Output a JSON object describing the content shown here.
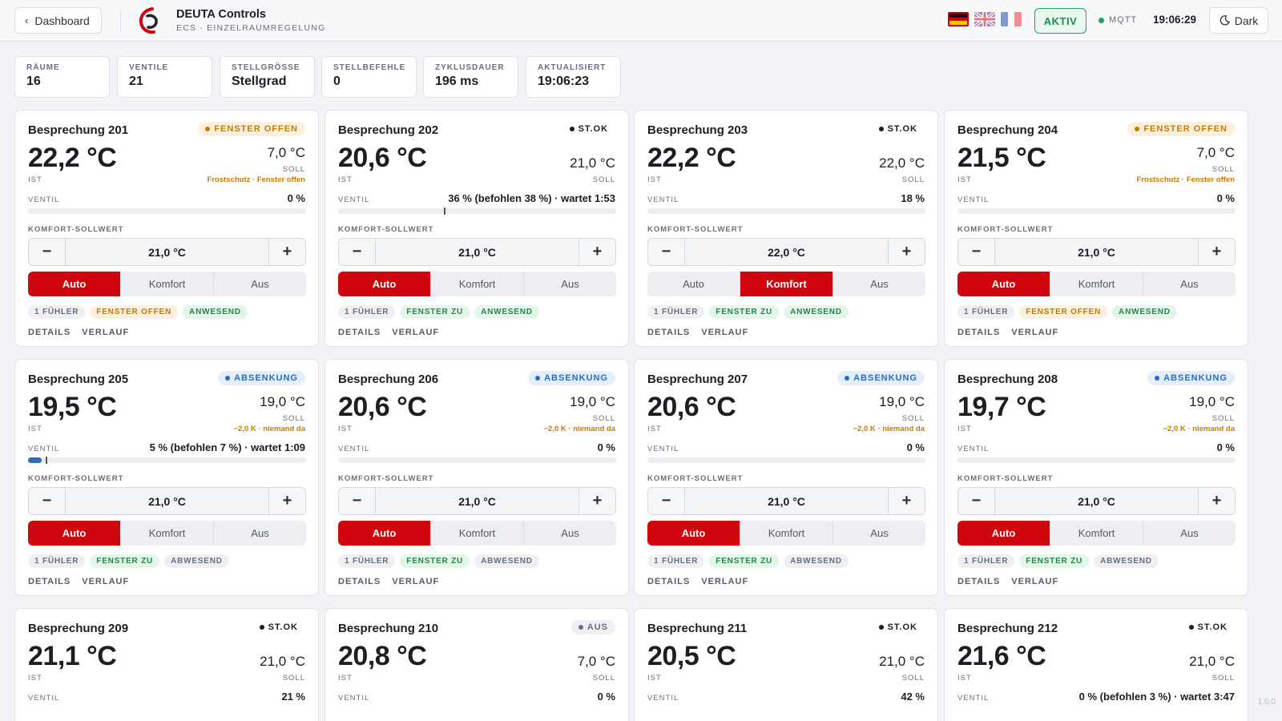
{
  "header": {
    "back_label": "Dashboard",
    "brand_title": "DEUTA Controls",
    "brand_subtitle": "ECS · EINZELRAUMREGELUNG",
    "status": "AKTIV",
    "mqtt": "MQTT",
    "clock": "19:06:29",
    "theme_label": "Dark",
    "flags": [
      "german-flag",
      "uk-flag",
      "french-flag"
    ]
  },
  "stats": [
    {
      "label": "RÄUME",
      "value": "16"
    },
    {
      "label": "VENTILE",
      "value": "21"
    },
    {
      "label": "STELLGRÖSSE",
      "value": "Stellgrad"
    },
    {
      "label": "STELLBEFEHLE",
      "value": "0"
    },
    {
      "label": "ZYKLUSDAUER",
      "value": "196 ms"
    },
    {
      "label": "AKTUALISIERT",
      "value": "19:06:23"
    }
  ],
  "labels": {
    "ist": "IST",
    "soll": "SOLL",
    "ventil": "VENTIL",
    "komfort": "KOMFORT-SOLLWERT",
    "minus": "−",
    "plus": "+",
    "mode_auto": "Auto",
    "mode_komfort": "Komfort",
    "mode_aus": "Aus",
    "details": "DETAILS",
    "verlauf": "VERLAUF"
  },
  "rooms": [
    {
      "name": "Besprechung 201",
      "badge": "FENSTER OFFEN",
      "badge_type": "open",
      "ist": "22,2 °C",
      "soll": "7,0 °C",
      "soll_note": "Frostschutz · Fenster offen",
      "ventil": "0 %",
      "ventil_level": 0,
      "marker_level": null,
      "komfort": "21,0 °C",
      "mode": "Auto",
      "tags": [
        {
          "t": "1 FÜHLER",
          "c": "gray"
        },
        {
          "t": "FENSTER OFFEN",
          "c": "orange"
        },
        {
          "t": "ANWESEND",
          "c": "green"
        }
      ]
    },
    {
      "name": "Besprechung 202",
      "badge": "ST.OK",
      "badge_type": "ok",
      "ist": "20,6 °C",
      "soll": "21,0 °C",
      "soll_note": "",
      "ventil": "36 % (befohlen 38 %) · wartet 1:53",
      "ventil_level": 0,
      "marker_level": 38,
      "komfort": "21,0 °C",
      "mode": "Auto",
      "tags": [
        {
          "t": "1 FÜHLER",
          "c": "gray"
        },
        {
          "t": "FENSTER ZU",
          "c": "green"
        },
        {
          "t": "ANWESEND",
          "c": "green"
        }
      ]
    },
    {
      "name": "Besprechung 203",
      "badge": "ST.OK",
      "badge_type": "ok",
      "ist": "22,2 °C",
      "soll": "22,0 °C",
      "soll_note": "",
      "ventil": "18 %",
      "ventil_level": 0,
      "marker_level": null,
      "komfort": "22,0 °C",
      "mode": "Komfort",
      "tags": [
        {
          "t": "1 FÜHLER",
          "c": "gray"
        },
        {
          "t": "FENSTER ZU",
          "c": "green"
        },
        {
          "t": "ANWESEND",
          "c": "green"
        }
      ]
    },
    {
      "name": "Besprechung 204",
      "badge": "FENSTER OFFEN",
      "badge_type": "open",
      "ist": "21,5 °C",
      "soll": "7,0 °C",
      "soll_note": "Frostschutz · Fenster offen",
      "ventil": "0 %",
      "ventil_level": 0,
      "marker_level": null,
      "komfort": "21,0 °C",
      "mode": "Auto",
      "tags": [
        {
          "t": "1 FÜHLER",
          "c": "gray"
        },
        {
          "t": "FENSTER OFFEN",
          "c": "orange"
        },
        {
          "t": "ANWESEND",
          "c": "green"
        }
      ]
    },
    {
      "name": "Besprechung 205",
      "badge": "ABSENKUNG",
      "badge_type": "ab",
      "ist": "19,5 °C",
      "soll": "19,0 °C",
      "soll_note": "−2,0 K · niemand da",
      "ventil": "5 % (befohlen 7 %) · wartet 1:09",
      "ventil_level": 5,
      "marker_level": 7,
      "komfort": "21,0 °C",
      "mode": "Auto",
      "tags": [
        {
          "t": "1 FÜHLER",
          "c": "gray"
        },
        {
          "t": "FENSTER ZU",
          "c": "green"
        },
        {
          "t": "ABWESEND",
          "c": "gray"
        }
      ]
    },
    {
      "name": "Besprechung 206",
      "badge": "ABSENKUNG",
      "badge_type": "ab",
      "ist": "20,6 °C",
      "soll": "19,0 °C",
      "soll_note": "−2,0 K · niemand da",
      "ventil": "0 %",
      "ventil_level": 0,
      "marker_level": null,
      "komfort": "21,0 °C",
      "mode": "Auto",
      "tags": [
        {
          "t": "1 FÜHLER",
          "c": "gray"
        },
        {
          "t": "FENSTER ZU",
          "c": "green"
        },
        {
          "t": "ABWESEND",
          "c": "gray"
        }
      ]
    },
    {
      "name": "Besprechung 207",
      "badge": "ABSENKUNG",
      "badge_type": "ab",
      "ist": "20,6 °C",
      "soll": "19,0 °C",
      "soll_note": "−2,0 K · niemand da",
      "ventil": "0 %",
      "ventil_level": 0,
      "marker_level": null,
      "komfort": "21,0 °C",
      "mode": "Auto",
      "tags": [
        {
          "t": "1 FÜHLER",
          "c": "gray"
        },
        {
          "t": "FENSTER ZU",
          "c": "green"
        },
        {
          "t": "ABWESEND",
          "c": "gray"
        }
      ]
    },
    {
      "name": "Besprechung 208",
      "badge": "ABSENKUNG",
      "badge_type": "ab",
      "ist": "19,7 °C",
      "soll": "19,0 °C",
      "soll_note": "−2,0 K · niemand da",
      "ventil": "0 %",
      "ventil_level": 0,
      "marker_level": null,
      "komfort": "21,0 °C",
      "mode": "Auto",
      "tags": [
        {
          "t": "1 FÜHLER",
          "c": "gray"
        },
        {
          "t": "FENSTER ZU",
          "c": "green"
        },
        {
          "t": "ABWESEND",
          "c": "gray"
        }
      ]
    },
    {
      "name": "Besprechung 209",
      "badge": "ST.OK",
      "badge_type": "ok",
      "ist": "21,1 °C",
      "soll": "21,0 °C",
      "soll_note": "",
      "ventil": "21 %"
    },
    {
      "name": "Besprechung 210",
      "badge": "AUS",
      "badge_type": "aus",
      "ist": "20,8 °C",
      "soll": "7,0 °C",
      "soll_note": "",
      "ventil": "0 %"
    },
    {
      "name": "Besprechung 211",
      "badge": "ST.OK",
      "badge_type": "ok",
      "ist": "20,5 °C",
      "soll": "21,0 °C",
      "soll_note": "",
      "ventil": "42 %"
    },
    {
      "name": "Besprechung 212",
      "badge": "ST.OK",
      "badge_type": "ok",
      "ist": "21,6 °C",
      "soll": "21,0 °C",
      "soll_note": "",
      "ventil": "0 % (befohlen 3 %) · wartet 3:47"
    }
  ],
  "version": "1.0.0",
  "colors": {
    "brand_red": "#d0060f",
    "accent_blue": "#2a6cc0",
    "ok_green": "#23884b",
    "warn_orange": "#c77b06"
  }
}
